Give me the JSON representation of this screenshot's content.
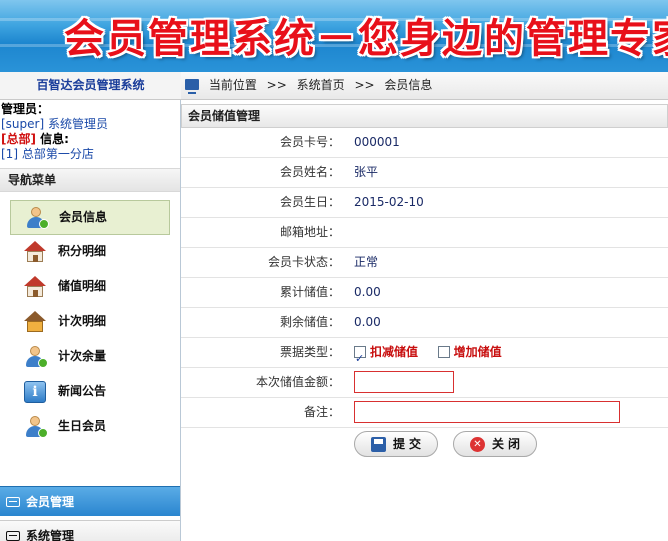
{
  "banner": {
    "title": "会员管理系统－您身边的管理专家"
  },
  "header": {
    "system_name": "百智达会员管理系统",
    "location_label": "当前位置",
    "breadcrumb_sep": ">>",
    "breadcrumb": [
      "系统首页",
      "会员信息"
    ]
  },
  "user": {
    "admin_label": "管理员：",
    "admin_value": "[super] 系统管理员",
    "branch_tag": "[总部]",
    "info_label": " 信息:",
    "branch_value": "[1] 总部第一分店"
  },
  "nav": {
    "title": "导航菜单",
    "items": [
      {
        "label": "会员信息",
        "icon": "member-icon",
        "active": true
      },
      {
        "label": "积分明细",
        "icon": "house-icon"
      },
      {
        "label": "储值明细",
        "icon": "house-icon"
      },
      {
        "label": "计次明细",
        "icon": "building-icon"
      },
      {
        "label": "计次余量",
        "icon": "member-icon"
      },
      {
        "label": "新闻公告",
        "icon": "info-icon"
      },
      {
        "label": "生日会员",
        "icon": "member-icon"
      }
    ],
    "accordion": [
      {
        "label": "会员管理",
        "active": true
      },
      {
        "label": "系统管理",
        "active": false
      }
    ]
  },
  "form": {
    "title": "会员储值管理",
    "rows": [
      {
        "label": "会员卡号：",
        "value": "000001"
      },
      {
        "label": "会员姓名：",
        "value": "张平"
      },
      {
        "label": "会员生日：",
        "value": "2015-02-10"
      },
      {
        "label": "邮箱地址：",
        "value": ""
      },
      {
        "label": "会员卡状态：",
        "value": "正常"
      },
      {
        "label": "累计储值：",
        "value": "0.00"
      },
      {
        "label": "剩余储值：",
        "value": "0.00"
      }
    ],
    "ticket_type": {
      "label": "票据类型：",
      "options": [
        {
          "label": "扣减储值",
          "checked": true
        },
        {
          "label": "增加储值",
          "checked": false
        }
      ]
    },
    "amount": {
      "label": "本次储值金额：",
      "value": ""
    },
    "note": {
      "label": "备注：",
      "value": ""
    },
    "submit_label": "提交",
    "close_label": "关闭"
  }
}
